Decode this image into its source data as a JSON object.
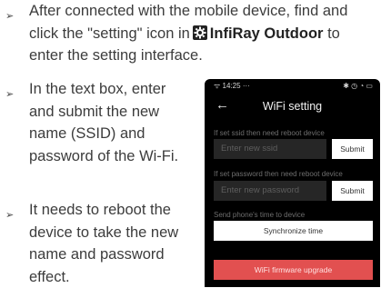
{
  "bullets": [
    {
      "pre": "After connected with the mobile device, find and click the \"setting\" icon in",
      "app": "InfiRay Outdoor",
      "post": "to enter the setting interface."
    },
    {
      "text": "In the text box, enter and submit the new name (SSID) and password of the Wi-Fi."
    },
    {
      "text": "It needs to reboot the device to take the new name and password effect."
    }
  ],
  "phone": {
    "status_time": "14:25",
    "status_left_prefix": "ᯤ",
    "status_left_suffix": "···",
    "status_right": "✱ ◷ ◔ ▭",
    "title": "WiFi setting",
    "ssid_hint": "If set ssid then need reboot device",
    "ssid_placeholder": "Enter new ssid",
    "submit_label": "Submit",
    "pwd_hint": "If set password then need reboot device",
    "pwd_placeholder": "Enter new password",
    "time_hint": "Send phone's time to device",
    "sync_label": "Synchronize time",
    "firmware_label": "WiFi firmware upgrade"
  },
  "colors": {
    "firmware_button": "#e25050",
    "phone_background": "#000000"
  }
}
